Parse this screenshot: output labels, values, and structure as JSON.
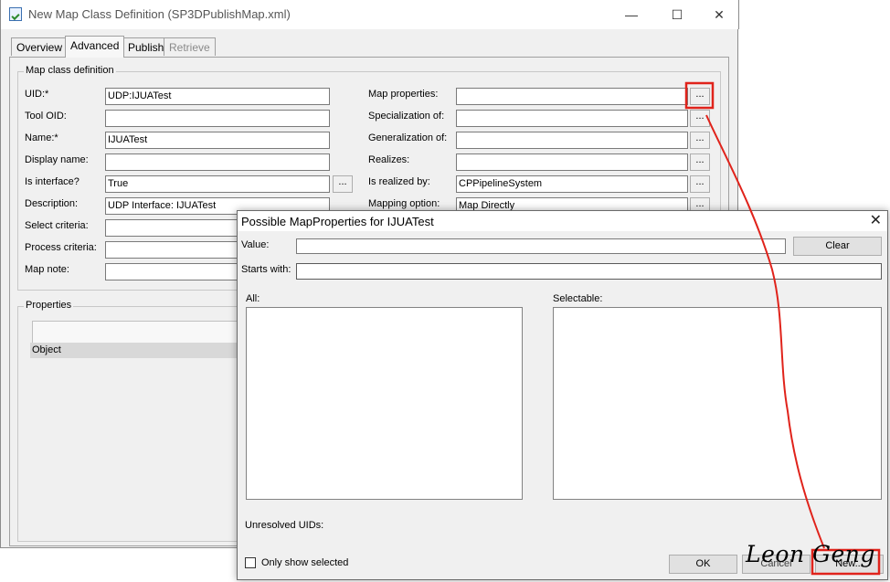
{
  "main_window": {
    "title": "New Map Class Definition (SP3DPublishMap.xml)",
    "controls": {
      "minimize": "—",
      "maximize": "☐",
      "close": "✕"
    },
    "tabs": [
      {
        "label": "Overview",
        "state": "normal"
      },
      {
        "label": "Advanced",
        "state": "active"
      },
      {
        "label": "Publish",
        "state": "normal"
      },
      {
        "label": "Retrieve",
        "state": "disabled"
      }
    ],
    "map_class_group_title": "Map class definition",
    "left_fields": [
      {
        "label": "UID:*",
        "value": "UDP:IJUATest"
      },
      {
        "label": "Tool OID:",
        "value": ""
      },
      {
        "label": "Name:*",
        "value": "IJUATest"
      },
      {
        "label": "Display name:",
        "value": ""
      },
      {
        "label": "Is interface?",
        "value": "True"
      },
      {
        "label": "Description:",
        "value": "UDP Interface: IJUATest"
      },
      {
        "label": "Select criteria:",
        "value": ""
      },
      {
        "label": "Process criteria:",
        "value": ""
      },
      {
        "label": "Map note:",
        "value": ""
      }
    ],
    "right_fields": [
      {
        "label": "Map properties:",
        "value": ""
      },
      {
        "label": "Specialization of:",
        "value": ""
      },
      {
        "label": "Generalization of:",
        "value": ""
      },
      {
        "label": "Realizes:",
        "value": ""
      },
      {
        "label": "Is realized by:",
        "value": "CPPipelineSystem"
      },
      {
        "label": "Mapping option:",
        "value": "Map Directly"
      }
    ],
    "ellipsis_label": "...",
    "properties_group_title": "Properties",
    "properties_column": "Object"
  },
  "popup": {
    "title": "Possible MapProperties for IJUATest",
    "close": "✕",
    "value_label": "Value:",
    "value_input": "",
    "clear_button": "Clear",
    "starts_with_label": "Starts with:",
    "starts_with_input": "",
    "all_label": "All:",
    "selectable_label": "Selectable:",
    "unresolved_label": "Unresolved UIDs:",
    "only_show_selected_label": "Only show selected",
    "only_show_selected_checked": false,
    "ok_button": "OK",
    "cancel_button": "Cancel",
    "new_button": "New..."
  },
  "annotation": {
    "signature": "Leon Geng",
    "color": "#e0231b"
  }
}
